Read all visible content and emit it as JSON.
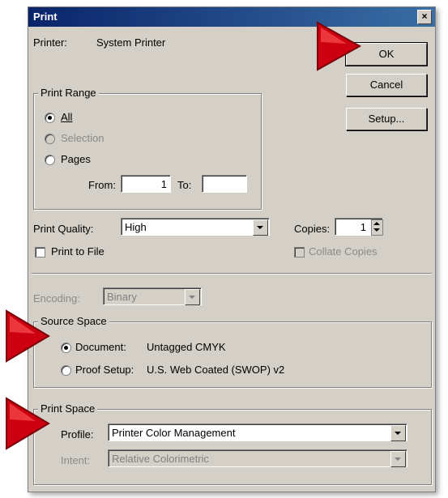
{
  "window": {
    "title": "Print",
    "close_glyph": "×"
  },
  "printer": {
    "label": "Printer:",
    "value": "System Printer"
  },
  "buttons": {
    "ok": "OK",
    "cancel": "Cancel",
    "setup": "Setup..."
  },
  "print_range": {
    "legend": "Print Range",
    "all": "All",
    "selection": "Selection",
    "pages": "Pages",
    "from_label": "From:",
    "from_value": "1",
    "to_label": "To:",
    "to_value": "",
    "selected": "All"
  },
  "print_quality": {
    "label": "Print Quality:",
    "value": "High"
  },
  "copies": {
    "label": "Copies:",
    "value": "1"
  },
  "print_to_file": {
    "label": "Print to File",
    "checked": false
  },
  "collate": {
    "label": "Collate Copies",
    "checked": false,
    "enabled": false
  },
  "encoding": {
    "label": "Encoding:",
    "value": "Binary",
    "enabled": false
  },
  "source_space": {
    "legend": "Source Space",
    "document_label": "Document:",
    "document_value": "Untagged CMYK",
    "proof_label": "Proof Setup:",
    "proof_value": "U.S. Web Coated (SWOP) v2",
    "selected": "Document"
  },
  "print_space": {
    "legend": "Print Space",
    "profile_label": "Profile:",
    "profile_value": "Printer Color Management",
    "intent_label": "Intent:",
    "intent_value": "Relative Colorimetric"
  },
  "colors": {
    "arrow": "#cc0010",
    "titlebar": "#0a246a",
    "face": "#d4d0c8"
  }
}
